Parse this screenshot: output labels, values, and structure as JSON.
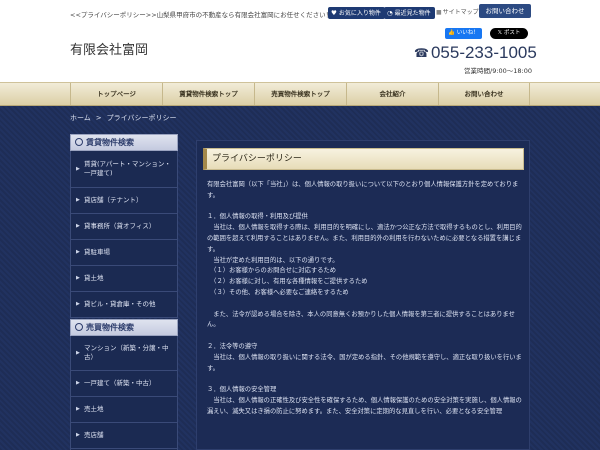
{
  "header": {
    "tagline": "<<プライバシーポリシー>>山梨県甲府市の不動産なら有限会社富岡にお任せください！",
    "fav_button": "お気に入り物件",
    "recent_button": "最近見た物件",
    "sitemap": "サイトマップ",
    "contact_button": "お問い合わせ",
    "company": "有限会社富岡",
    "like_button": "いいね！",
    "post_button": "ポスト",
    "phone": "055-233-1005",
    "hours": "営業時間/9:00～18:00"
  },
  "nav": {
    "items": [
      "トップページ",
      "賃貸物件検索トップ",
      "売買物件検索トップ",
      "会社紹介",
      "お問い合わせ"
    ]
  },
  "breadcrumb": {
    "home": "ホーム",
    "separator": ">",
    "current": "プライバシーポリシー"
  },
  "sidebar": {
    "rental": {
      "title": "賃貸物件検索",
      "items": [
        "賃貸(アパート・マンション・一戸建て)",
        "貸店舗（テナント）",
        "貸事務所（貸オフィス）",
        "貸駐車場",
        "貸土地",
        "貸ビル・貸倉庫・その他"
      ]
    },
    "sale": {
      "title": "売買物件検索",
      "items": [
        "マンション（新築・分譲・中古）",
        "一戸建て（新築・中古）",
        "売土地",
        "売店舗"
      ]
    }
  },
  "content": {
    "title": "プライバシーポリシー",
    "paragraphs": [
      "有限会社富岡（以下「当社」）は、個人情報の取り扱いについて以下のとおり個人情報保護方針を定めております。",
      "",
      "１．個人情報の取得・利用及び提供",
      "　当社は、個人情報を取得する際は、利用目的を明確にし、適法かつ公正な方法で取得するものとし、利用目的の範囲を超えて利用することはありません。また、利用目的外の利用を行わないために必要となる措置を講じます。",
      "　当社が定めた利用目的は、以下の通りです。",
      "　（１）お客様からのお問合せに対応するため",
      "　（２）お客様に対し、有用な各種情報をご提供するため",
      "　（３）その他、お客様へ必要なご連絡をするため",
      "",
      "　また、法令が認める場合を除き、本人の同意無くお預かりした個人情報を第三者に提供することはありません。",
      "",
      "２．法令等の遵守",
      "　当社は、個人情報の取り扱いに関する法令、国が定める指針、その他規範を遵守し、適正な取り扱いを行います。",
      "",
      "３．個人情報の安全管理",
      "　当社は、個人情報の正確性及び安全性を確保するため、個人情報保護のための安全対策を実施し、個人情報の漏えい、滅失又はき損の防止に努めます。また、安全対策に定期的な見直しを行い、必要となる安全管理"
    ]
  },
  "colors": {
    "navy": "#1b2a52",
    "button_blue": "#1e3a73",
    "nav_gold": "#dccfa6"
  }
}
